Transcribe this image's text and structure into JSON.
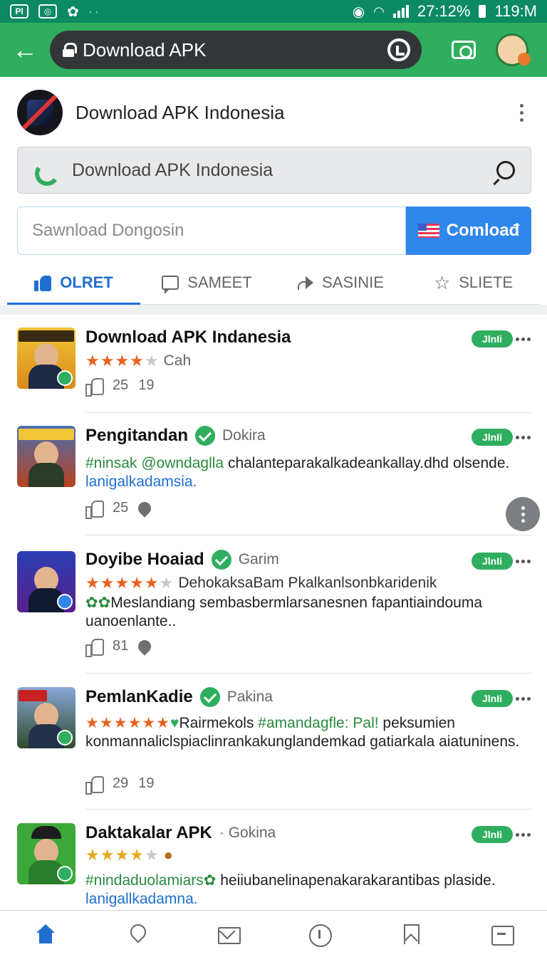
{
  "status_bar": {
    "left_icons": [
      "Pl",
      "photo-icon",
      "bluetooth-icon"
    ],
    "dots": "· ·",
    "battery": "27:12%",
    "time": "119:M"
  },
  "browser": {
    "url": "Download APK"
  },
  "app": {
    "title": "Download APK Indonesia"
  },
  "search": {
    "text": "Download APK Indonesia"
  },
  "download": {
    "placeholder": "Sawnload Dongosin",
    "button_label": "Comloađ"
  },
  "tabs": [
    {
      "label": "OLRET",
      "icon": "like-icon",
      "active": true
    },
    {
      "label": "SAMEET",
      "icon": "comment-icon",
      "active": false
    },
    {
      "label": "SASINIE",
      "icon": "share-icon",
      "active": false
    },
    {
      "label": "SLIETE",
      "icon": "star-icon",
      "active": false
    }
  ],
  "posts": [
    {
      "name": "Download APK Indanesia",
      "handle": "",
      "pill": "JlnIi",
      "stars": "★★★★",
      "stars_off": "★",
      "stars_tail": "Cah",
      "likes": "25",
      "second": "19"
    },
    {
      "name": "Pengitandan",
      "handle": "Dokira",
      "pill": "JlnIi",
      "text_green": "#ninsak @owndaglla",
      "text_mid": " chalanteparakalkadeankallay.dhd olsende. ",
      "text_blue": "lanigalkadamsia.",
      "likes": "25"
    },
    {
      "name": "Doyibe Hoaiad",
      "handle": "Garim",
      "pill": "JlnIi",
      "stars": "★★★★★",
      "stars_off": "★",
      "stars_tail": "DehokaksaBam Pkalkanlsonbkaridenik",
      "text_green": "",
      "text_mid": "Meslandiang sembasbermlarsanesnen fapantiaindouma uanoenlante..",
      "likes": "81"
    },
    {
      "name": "PemlanKadie",
      "handle": "Pakina",
      "pill": "JlnIi",
      "stars": "★★★★★★",
      "stars_tail_before": "Rairmekols ",
      "stars_tail_green": "#amandagfle: Pal!",
      "stars_tail_after": " peksumien",
      "text_mid": "konmannaliclspiaclinrankakunglandemkad gatiarkala aiatuninens.",
      "likes": "29",
      "second": "19"
    },
    {
      "name": "Daktakalar APK",
      "handle": "Gokina",
      "pill": "JlnIi",
      "stars": "★★★★",
      "stars_off": "★",
      "text_green": "#nindaduolamiars",
      "text_mid": " heiiubanelinapenakarakarantibas plaside. ",
      "text_blue": "lanigallkadamna."
    }
  ],
  "bottom_nav": [
    "home-icon",
    "location-icon",
    "mail-icon",
    "info-icon",
    "bookmark-icon",
    "message-icon"
  ],
  "colors": {
    "status_bar": "#0b8a63",
    "browser_bar": "#2fae5f",
    "accent_blue": "#2f86eb",
    "star": "#e8621e"
  }
}
